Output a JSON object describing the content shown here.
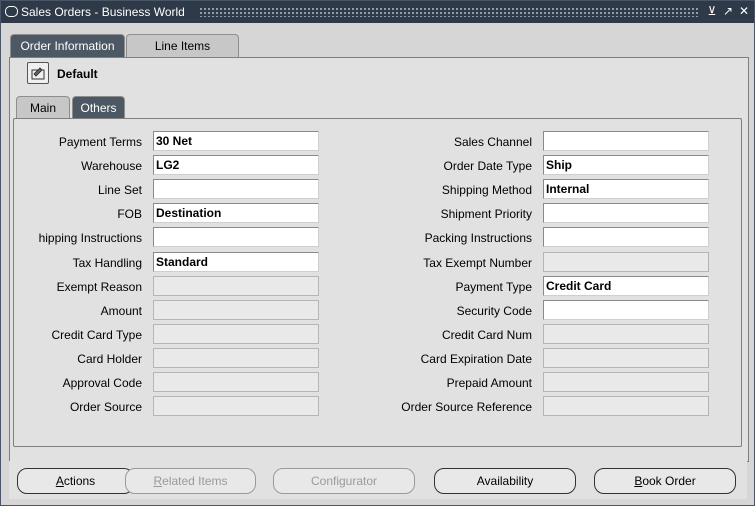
{
  "window": {
    "title": "Sales Orders - Business World",
    "minimize": "⊻",
    "maximize": "↗",
    "close": "✕"
  },
  "top_tabs": [
    {
      "label": "Order Information",
      "active": true
    },
    {
      "label": "Line Items",
      "active": false
    }
  ],
  "folder": {
    "label": "Default"
  },
  "sub_tabs": [
    {
      "label": "Main",
      "active": false
    },
    {
      "label": "Others",
      "active": true
    }
  ],
  "left_fields": [
    {
      "label": "Payment Terms",
      "value": "30 Net",
      "enabled": true
    },
    {
      "label": "Warehouse",
      "value": "LG2",
      "enabled": true
    },
    {
      "label": "Line Set",
      "value": "",
      "enabled": true
    },
    {
      "label": "FOB",
      "value": "Destination",
      "enabled": true
    },
    {
      "label": "hipping Instructions",
      "value": "",
      "enabled": true
    },
    {
      "label": "Tax Handling",
      "value": "Standard",
      "enabled": true
    },
    {
      "label": "Exempt Reason",
      "value": "",
      "enabled": false
    },
    {
      "label": "Amount",
      "value": "",
      "enabled": false
    },
    {
      "label": "Credit Card Type",
      "value": "",
      "enabled": false
    },
    {
      "label": "Card Holder",
      "value": "",
      "enabled": false
    },
    {
      "label": "Approval Code",
      "value": "",
      "enabled": false
    },
    {
      "label": "Order Source",
      "value": "",
      "enabled": false
    }
  ],
  "right_fields": [
    {
      "label": "Sales Channel",
      "value": "",
      "enabled": true
    },
    {
      "label": "Order Date Type",
      "value": "Ship",
      "enabled": true
    },
    {
      "label": "Shipping Method",
      "value": "Internal",
      "enabled": true
    },
    {
      "label": "Shipment Priority",
      "value": "",
      "enabled": true
    },
    {
      "label": "Packing Instructions",
      "value": "",
      "enabled": true
    },
    {
      "label": "Tax Exempt Number",
      "value": "",
      "enabled": false
    },
    {
      "label": "Payment Type",
      "value": "Credit Card",
      "enabled": true
    },
    {
      "label": "Security Code",
      "value": "",
      "enabled": true
    },
    {
      "label": "Credit Card Num",
      "value": "",
      "enabled": false
    },
    {
      "label": "Card Expiration Date",
      "value": "",
      "enabled": false
    },
    {
      "label": "Prepaid Amount",
      "value": "",
      "enabled": false
    },
    {
      "label": "Order Source Reference",
      "value": "",
      "enabled": false
    }
  ],
  "buttons": [
    {
      "first": "A",
      "rest": "ctions",
      "enabled": true
    },
    {
      "first": "R",
      "rest": "elated Items",
      "enabled": false
    },
    {
      "first": "C",
      "rest": "onfigurator",
      "enabled": false
    },
    {
      "first": "A",
      "rest": "vailability",
      "enabled": true,
      "no_underline": true
    },
    {
      "first": "B",
      "rest": "ook Order",
      "enabled": true
    }
  ]
}
